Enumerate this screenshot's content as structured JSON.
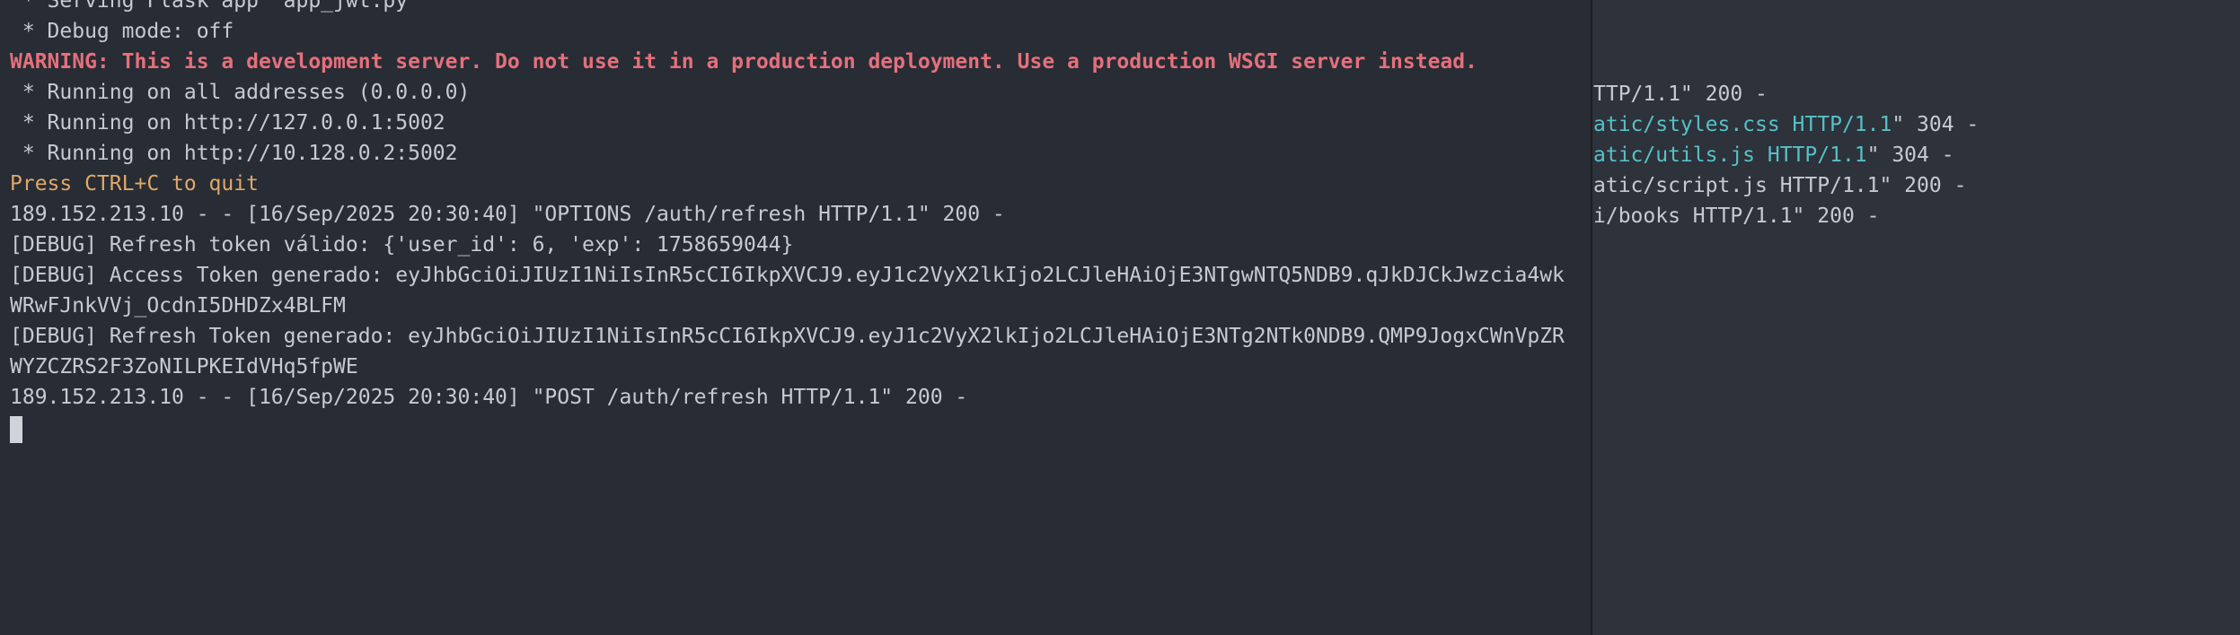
{
  "left_pane": {
    "lines": [
      " * Serving Flask app 'app_jwt.py'",
      " * Debug mode: off",
      "WARNING: This is a development server. Do not use it in a production deployment. Use a production WSGI server instead.",
      " * Running on all addresses (0.0.0.0)",
      " * Running on http://127.0.0.1:5002",
      " * Running on http://10.128.0.2:5002",
      "Press CTRL+C to quit",
      "189.152.213.10 - - [16/Sep/2025 20:30:40] \"OPTIONS /auth/refresh HTTP/1.1\" 200 -",
      "[DEBUG] Refresh token válido: {'user_id': 6, 'exp': 1758659044}",
      "[DEBUG] Access Token generado: eyJhbGciOiJIUzI1NiIsInR5cCI6IkpXVCJ9.eyJ1c2VyX2lkIjo2LCJleHAiOjE3NTgwNTQ5NDB9.qJkDJCkJwzcia4wk",
      "WRwFJnkVVj_OcdnI5DHDZx4BLFM",
      "[DEBUG] Refresh Token generado: eyJhbGciOiJIUzI1NiIsInR5cCI6IkpXVCJ9.eyJ1c2VyX2lkIjo2LCJleHAiOjE3NTg2NTk0NDB9.QMP9JogxCWnVpZR",
      "WYZCZRS2F3ZoNILPKEIdVHq5fpWE",
      "189.152.213.10 - - [16/Sep/2025 20:30:40] \"POST /auth/refresh HTTP/1.1\" 200 -"
    ]
  },
  "right_pane": {
    "lines": [
      {
        "a": "TTP/1.1\" 200 -",
        "b": "",
        "c": ""
      },
      {
        "a": "atic/styles.css HTTP/1.1",
        "b": "\" 304 -",
        "c": ""
      },
      {
        "a": "atic/utils.js HTTP/1.1",
        "b": "\" 304 -",
        "c": ""
      },
      {
        "a": "atic/script.js HTTP/1.1\" 200 -",
        "b": "",
        "c": ""
      },
      {
        "a": "i/books HTTP/1.1\" 200 -",
        "b": "",
        "c": ""
      }
    ]
  },
  "colors": {
    "background": "#282c34",
    "text": "#c6cbd3",
    "warning": "#e5707c",
    "prompt_hint": "#e0a86b",
    "link": "#56c1c9"
  },
  "cursor": "block-cursor"
}
